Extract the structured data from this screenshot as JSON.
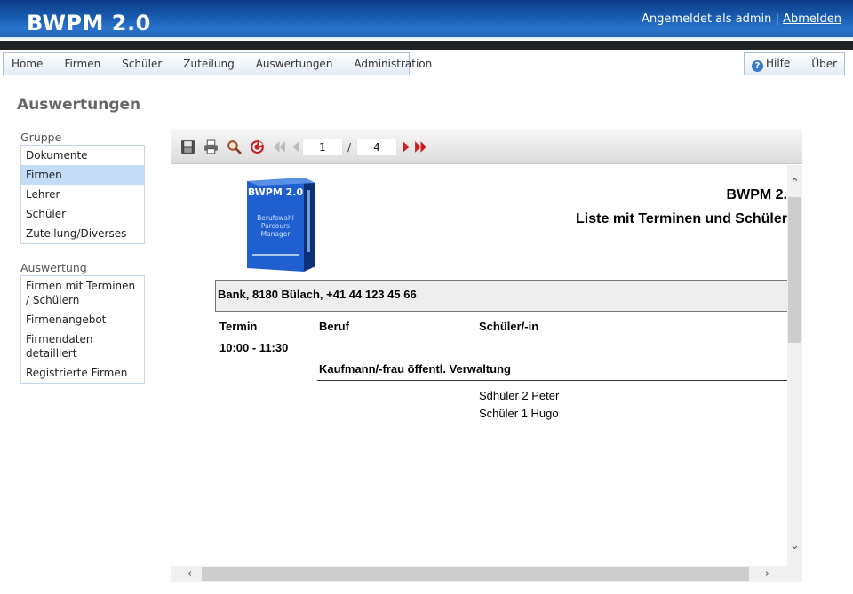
{
  "header": {
    "brand": "BWPM 2.0",
    "login_text": "Angemeldet als admin",
    "separator": "|",
    "logout_label": "Abmelden"
  },
  "menu": {
    "left_items": [
      "Home",
      "Firmen",
      "Schüler",
      "Zuteilung",
      "Auswertungen",
      "Administration"
    ],
    "help_label": "Hilfe",
    "about_label": "Über"
  },
  "page_title": "Auswertungen",
  "sidebar": {
    "group_label": "Gruppe",
    "group_items": [
      "Dokumente",
      "Firmen",
      "Lehrer",
      "Schüler",
      "Zuteilung/Diverses"
    ],
    "group_active": "Firmen",
    "report_label": "Auswertung",
    "report_items": [
      "Firmen mit Terminen / Schülern",
      "Firmenangebot",
      "Firmendaten detailliert",
      "Registrierte Firmen"
    ]
  },
  "viewer": {
    "current_page": "1",
    "page_separator": "/",
    "total_pages": "4",
    "icons": [
      "save-icon",
      "print-icon",
      "zoom-icon",
      "refresh-icon",
      "first-page-icon",
      "prev-page-icon",
      "next-page-icon",
      "last-page-icon"
    ]
  },
  "report": {
    "title_line1": "BWPM 2.",
    "title_line2": "Liste mit Terminen und Schüler",
    "firm_line": "Bank, 8180 Bülach, +41 44 123 45 66",
    "col_termin": "Termin",
    "col_beruf": "Beruf",
    "col_schueler": "Schüler/-in",
    "time_slot": "10:00 - 11:30",
    "profession": "Kaufmann/-frau öffentl. Verwaltung",
    "students": [
      "Sdhüler 2 Peter",
      "Schüler 1 Hugo"
    ],
    "logo": {
      "title": "BWPM 2.0",
      "lines": [
        "Berufswahl",
        "Parcours",
        "Manager"
      ]
    }
  },
  "colors": {
    "header_blue": "#1a5fb4",
    "active_item": "#c5dcf6",
    "next_arrow_red": "#cc1f1f"
  }
}
